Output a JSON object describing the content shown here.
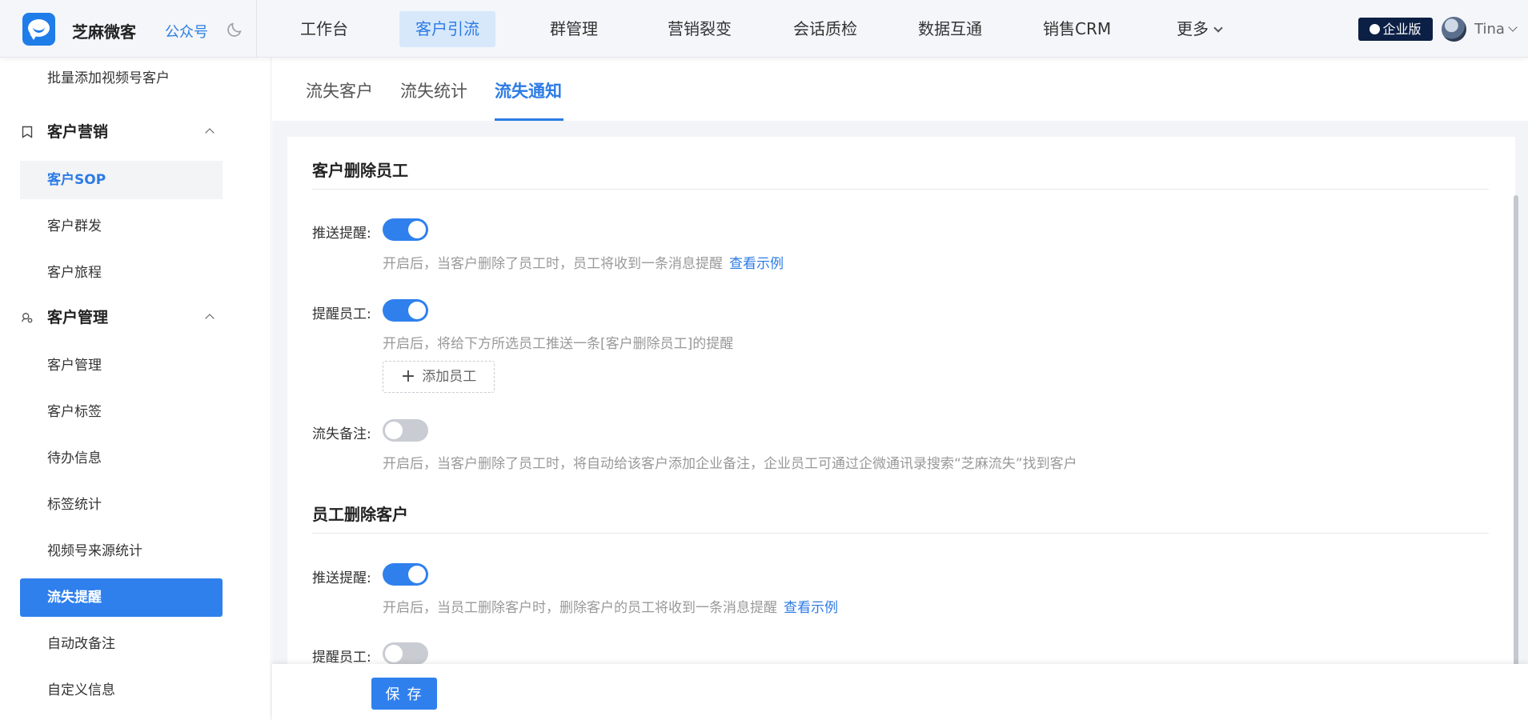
{
  "brand": {
    "app_name": "芝麻微客",
    "gzh": "公众号"
  },
  "topnav": {
    "items": [
      {
        "label": "工作台"
      },
      {
        "label": "客户引流"
      },
      {
        "label": "群管理"
      },
      {
        "label": "营销裂变"
      },
      {
        "label": "会话质检"
      },
      {
        "label": "数据互通"
      },
      {
        "label": "销售CRM"
      },
      {
        "label": "更多"
      }
    ],
    "active_index": 1,
    "enterprise_badge": "企业版",
    "user_name": "Tina"
  },
  "sidebar": {
    "top_item": "批量添加视频号客户",
    "groups": [
      {
        "label": "客户营销",
        "items": [
          "客户SOP",
          "客户群发",
          "客户旅程"
        ]
      },
      {
        "label": "客户管理",
        "items": [
          "客户管理",
          "客户标签",
          "待办信息",
          "标签统计",
          "视频号来源统计",
          "流失提醒",
          "自动改备注",
          "自定义信息"
        ]
      }
    ],
    "soft_selected": "客户SOP",
    "active": "流失提醒"
  },
  "tabs": [
    {
      "label": "流失客户"
    },
    {
      "label": "流失统计"
    },
    {
      "label": "流失通知"
    }
  ],
  "active_tab": "流失通知",
  "sections": {
    "customer_deletes_staff": {
      "title": "客户删除员工",
      "push_label": "推送提醒:",
      "push_on": true,
      "push_hint": "开启后，当客户删除了员工时，员工将收到一条消息提醒",
      "push_link": "查看示例",
      "remind_label": "提醒员工:",
      "remind_on": true,
      "remind_hint": "开启后，将给下方所选员工推送一条[客户删除员工]的提醒",
      "add_staff": "添加员工",
      "remark_label": "流失备注:",
      "remark_on": false,
      "remark_hint": "开启后，当客户删除了员工时，将自动给该客户添加企业备注，企业员工可通过企微通讯录搜索“芝麻流失”找到客户"
    },
    "staff_deletes_customer": {
      "title": "员工删除客户",
      "push_label": "推送提醒:",
      "push_on": true,
      "push_hint": "开启后，当员工删除客户时，删除客户的员工将收到一条消息提醒",
      "push_link": "查看示例",
      "remind_label": "提醒员工:",
      "remind_on": false
    }
  },
  "footer": {
    "save": "保 存"
  },
  "colors": {
    "accent": "#2f80ed",
    "badge_bg": "#0c1f45",
    "hint": "#999999"
  }
}
